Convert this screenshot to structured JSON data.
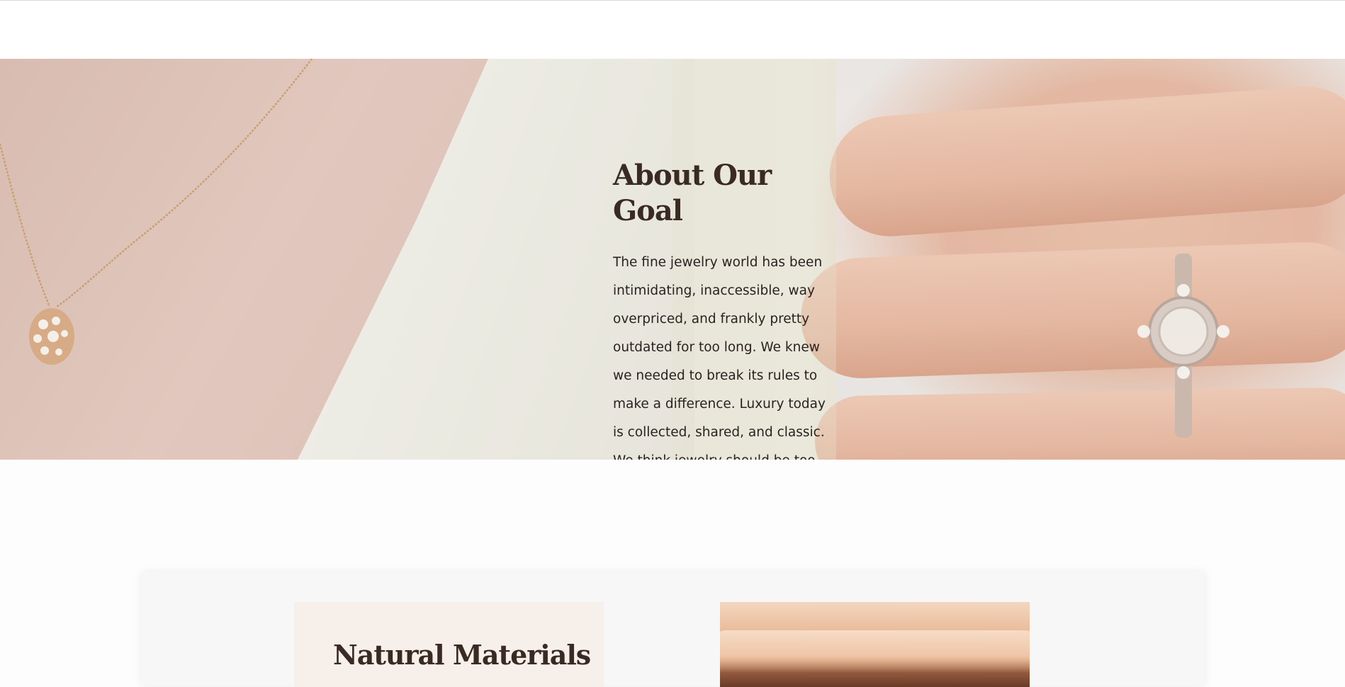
{
  "about": {
    "title": "About Our Goal",
    "body": "The fine jewelry world has been intimidating, inaccessible, way overpriced, and frankly pretty outdated for too long. We knew we needed to break its rules to make a difference. Luxury today is collected, shared, and classic. We think jewelry should be too."
  },
  "features": {
    "materials_title": "Natural Materials"
  },
  "colors": {
    "heading": "#3a2a24",
    "body_text": "#2a2220",
    "card_bg": "#f7f7f7",
    "materials_bg": "#f7efe9"
  },
  "images": {
    "hero": "necklace-and-ring-photo",
    "feature_photo": "hand-closeup-photo"
  }
}
